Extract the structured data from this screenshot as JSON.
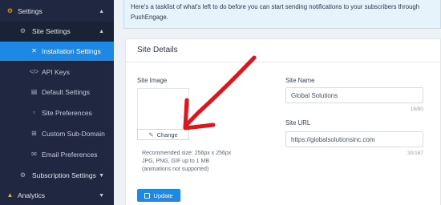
{
  "sidebar": {
    "settings_label": "Settings",
    "site_settings_label": "Site Settings",
    "items": [
      {
        "label": "Installation Settings"
      },
      {
        "label": "API Keys"
      },
      {
        "label": "Default Settings"
      },
      {
        "label": "Site Preferences"
      },
      {
        "label": "Custom Sub-Domain"
      },
      {
        "label": "Email Preferences"
      }
    ],
    "subscription_settings_label": "Subscription Settings",
    "analytics_label": "Analytics",
    "colors": {
      "background": "#1f2840",
      "active": "#1e88e5",
      "accent_icon": "#f5b400"
    }
  },
  "info": {
    "text_line1": "Here's a tasklist of what's left to do before you can start sending notifications to your subscribers through",
    "text_line2": "PushEngage."
  },
  "card": {
    "title": "Site Details",
    "site_image_label": "Site Image",
    "change_label": "Change",
    "hint": {
      "line1": "Recommended size: 256px x 256px",
      "line2": "JPG, PNG, GIF up to 1 MB",
      "line3": "(animations not supported)"
    },
    "update_label": "Update",
    "site_name": {
      "label": "Site Name",
      "value": "Global Solutions",
      "counter": "16/80"
    },
    "site_url": {
      "label": "Site URL",
      "value": "https://globalsolutionsinc.com",
      "counter": "30/167"
    }
  },
  "annotation": {
    "arrow_color": "#e0141b"
  }
}
